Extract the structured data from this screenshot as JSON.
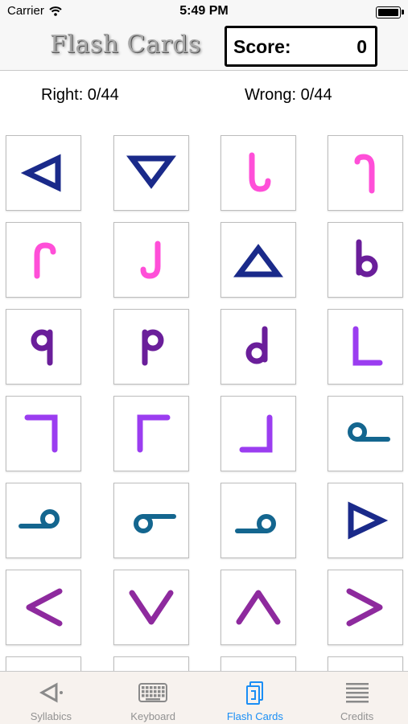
{
  "status_bar": {
    "carrier": "Carrier",
    "time": "5:49 PM"
  },
  "header": {
    "title": "Flash Cards",
    "score_label": "Score:",
    "score_value": "0"
  },
  "counters": {
    "right": "Right: 0/44",
    "wrong": "Wrong: 0/44"
  },
  "colors": {
    "blue": "#1a2a8a",
    "pink": "#ff4fd8",
    "purple": "#6a1e9a",
    "violet": "#9b3df0",
    "teal": "#14668f",
    "magenta": "#8e2a9e",
    "tab_active": "#1a8ef5",
    "tab_inactive": "#929292"
  },
  "cards": [
    {
      "glyph": "triangle-left",
      "color": "blue"
    },
    {
      "glyph": "triangle-down",
      "color": "blue"
    },
    {
      "glyph": "hook-up-left",
      "color": "pink"
    },
    {
      "glyph": "hook-down-left",
      "color": "pink"
    },
    {
      "glyph": "hook-top-left",
      "color": "pink"
    },
    {
      "glyph": "hook-bottom-left",
      "color": "pink"
    },
    {
      "glyph": "triangle-up",
      "color": "blue"
    },
    {
      "glyph": "loop-b",
      "color": "purple"
    },
    {
      "glyph": "loop-q",
      "color": "purple"
    },
    {
      "glyph": "loop-p",
      "color": "purple"
    },
    {
      "glyph": "loop-d",
      "color": "purple"
    },
    {
      "glyph": "corner-l",
      "color": "violet"
    },
    {
      "glyph": "corner-top-right",
      "color": "violet"
    },
    {
      "glyph": "corner-top-left",
      "color": "violet"
    },
    {
      "glyph": "corner-bottom-right",
      "color": "violet"
    },
    {
      "glyph": "loop-tail-right",
      "color": "teal"
    },
    {
      "glyph": "loop-tail-left",
      "color": "teal"
    },
    {
      "glyph": "loop-tail-right-up",
      "color": "teal"
    },
    {
      "glyph": "loop-tail-left-up",
      "color": "teal"
    },
    {
      "glyph": "triangle-right",
      "color": "blue"
    },
    {
      "glyph": "chevron-left",
      "color": "magenta"
    },
    {
      "glyph": "chevron-down",
      "color": "magenta"
    },
    {
      "glyph": "chevron-up",
      "color": "magenta"
    },
    {
      "glyph": "chevron-right",
      "color": "magenta"
    },
    {
      "glyph": "blank",
      "color": "blue"
    },
    {
      "glyph": "blank",
      "color": "blue"
    },
    {
      "glyph": "blank",
      "color": "blue"
    },
    {
      "glyph": "blank",
      "color": "blue"
    }
  ],
  "tabs": [
    {
      "label": "Syllabics",
      "icon": "syllabics-icon",
      "active": false
    },
    {
      "label": "Keyboard",
      "icon": "keyboard-icon",
      "active": false
    },
    {
      "label": "Flash Cards",
      "icon": "flash-cards-icon",
      "active": true
    },
    {
      "label": "Credits",
      "icon": "credits-icon",
      "active": false
    }
  ]
}
